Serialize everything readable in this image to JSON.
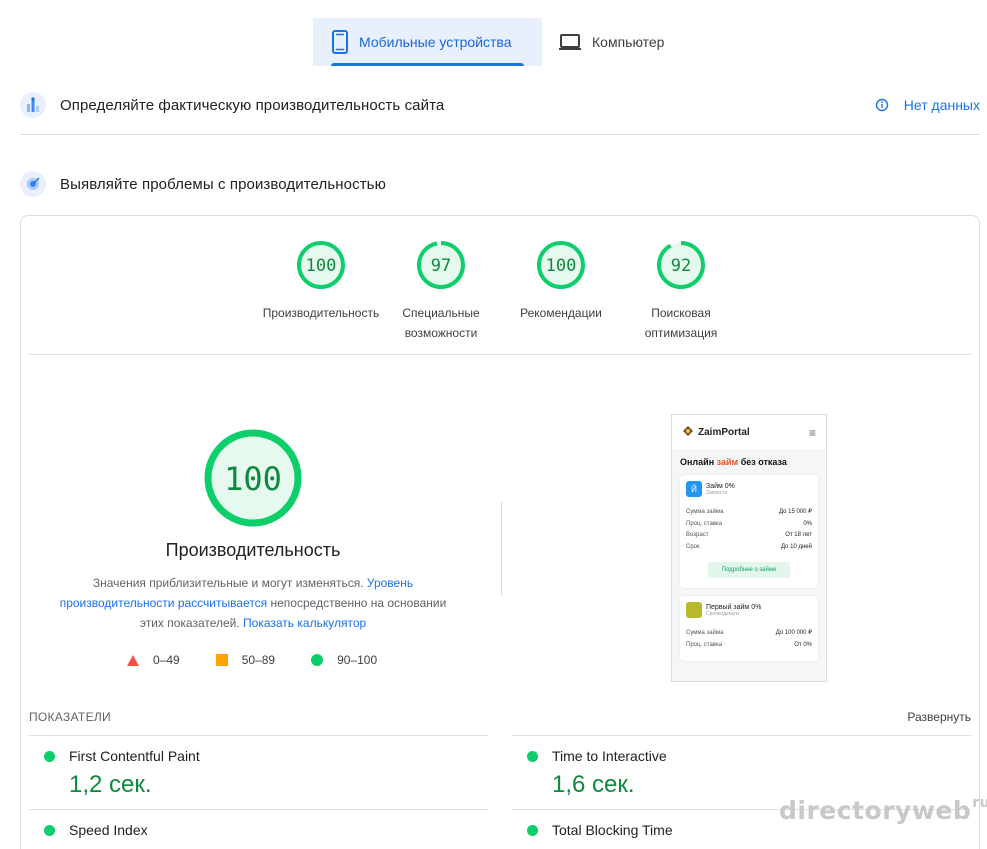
{
  "tabs": [
    {
      "label": "Мобильные устройства",
      "icon": "smartphone-icon",
      "active": true
    },
    {
      "label": "Компьютер",
      "icon": "laptop-icon",
      "active": false
    }
  ],
  "field_section": {
    "title": "Определяйте фактическую производительность сайта",
    "status": "Нет данных"
  },
  "lab_section": {
    "title": "Выявляйте проблемы с производительностью"
  },
  "scores": [
    {
      "value": "100",
      "label": "Производительность",
      "fraction": 1.0
    },
    {
      "value": "97",
      "label": "Специальные возможности",
      "fraction": 0.97
    },
    {
      "value": "100",
      "label": "Рекомендации",
      "fraction": 1.0
    },
    {
      "value": "92",
      "label": "Поисковая оптимизация",
      "fraction": 0.92
    }
  ],
  "performance": {
    "score": "100",
    "title": "Производительность",
    "desc_part1": "Значения приблизительные и могут изменяться. ",
    "desc_link1": "Уровень производительности рассчитывается",
    "desc_part2": " непосредственно на основании этих показателей. ",
    "desc_link2": "Показать калькулятор"
  },
  "legend": [
    {
      "label": "0–49",
      "shape": "triangle",
      "color": "#ff4e42"
    },
    {
      "label": "50–89",
      "shape": "square",
      "color": "#ffa400"
    },
    {
      "label": "90–100",
      "shape": "circle",
      "color": "#0cce6b"
    }
  ],
  "colors": {
    "pass": "#0cce6b",
    "pass_text": "#0d8a3e",
    "pass_bg": "#e6f9ee",
    "accent": "#1a73e8"
  },
  "screenshot": {
    "brand": "ZaimPortal",
    "heading_a": "Онлайн ",
    "heading_accent": "займ",
    "heading_b": " без отказа",
    "offers": [
      {
        "badge": "Й",
        "badge_color": "#2196f3",
        "name": "Займ 0%",
        "sub": "Zaimer.ru",
        "rows": [
          [
            "Сумма займа",
            "До 15 000 ₽"
          ],
          [
            "Проц. ставка",
            "0%"
          ],
          [
            "Возраст",
            "От 18 лет"
          ],
          [
            "Срок",
            "До 10 дней"
          ]
        ],
        "button": "Подробнее о займе"
      },
      {
        "badge": "",
        "badge_color": "#b8b82a",
        "name": "Первый займ 0%",
        "sub": "Срочноденьги",
        "rows": [
          [
            "Сумма займа",
            "До 100 000 ₽"
          ],
          [
            "Проц. ставка",
            "От 0%"
          ]
        ]
      }
    ]
  },
  "metrics": {
    "header": "ПОКАЗАТЕЛИ",
    "expand": "Развернуть",
    "left": [
      {
        "name": "First Contentful Paint",
        "value": "1,2 сек."
      },
      {
        "name": "Speed Index",
        "value": ""
      }
    ],
    "right": [
      {
        "name": "Time to Interactive",
        "value": "1,6 сек."
      },
      {
        "name": "Total Blocking Time",
        "value": ""
      }
    ]
  },
  "watermark": {
    "text": "directoryweb",
    "sup": "ru"
  }
}
